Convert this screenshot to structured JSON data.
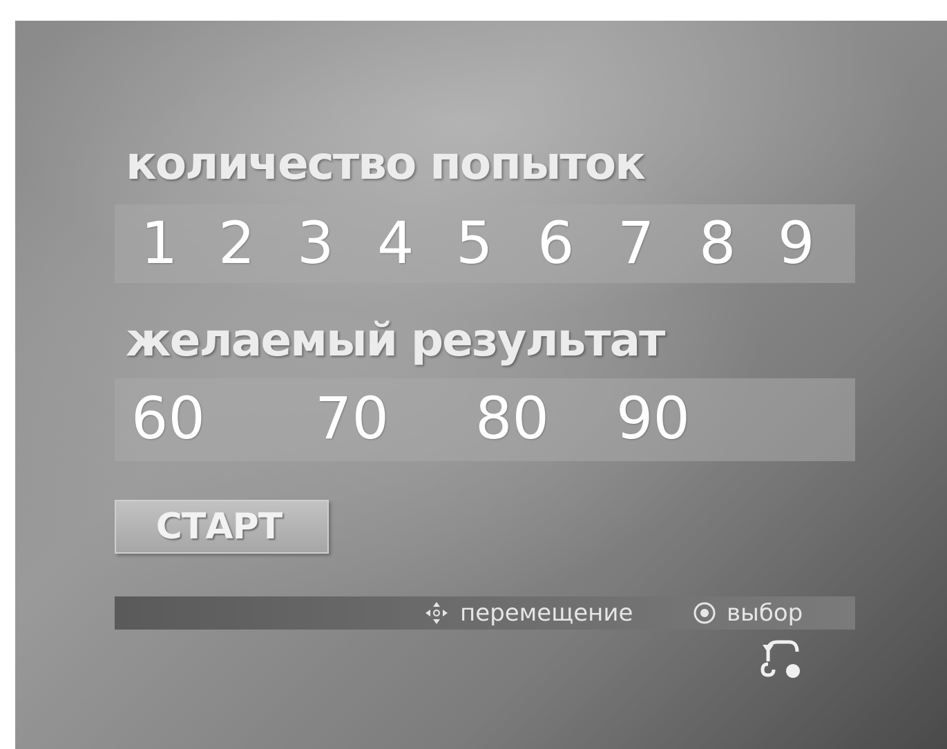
{
  "menu": {
    "tries_label": "количество попыток",
    "tries_options": [
      "1",
      "2",
      "3",
      "4",
      "5",
      "6",
      "7",
      "8",
      "9"
    ],
    "result_label": "желаемый результат",
    "result_options": [
      "60",
      "70",
      "80",
      "90"
    ],
    "start_label": "СТАРТ"
  },
  "help_bar": {
    "move_icon": "dpad-arrows-icon",
    "move_label": "перемещение",
    "select_icon": "enter-button-icon",
    "select_label": "выбор"
  },
  "return_icon": "return-icon"
}
